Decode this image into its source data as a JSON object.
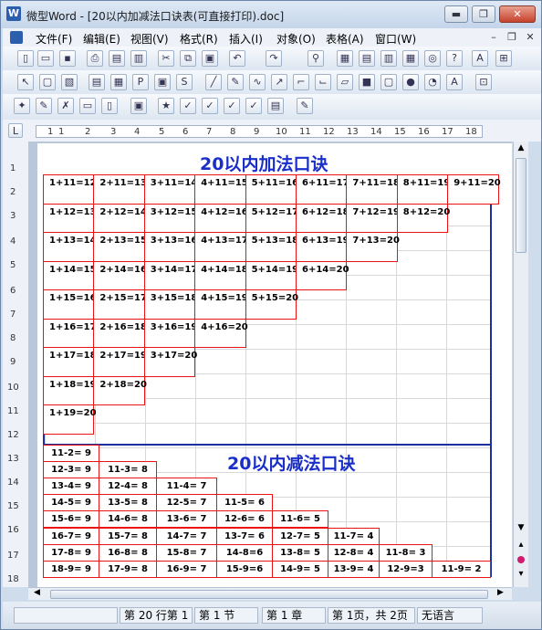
{
  "window": {
    "title": "微型Word - [20以内加减法口诀表(可直接打印).doc]",
    "min": "▬",
    "restore": "❐",
    "close": "✕"
  },
  "menu": [
    "文件(F)",
    "编辑(E)",
    "视图(V)",
    "格式(R)",
    "插入(I)",
    "对象(O)",
    "表格(A)",
    "窗口(W)"
  ],
  "ruler": [
    "1",
    "1",
    "2",
    "3",
    "4",
    "5",
    "6",
    "7",
    "8",
    "9",
    "10",
    "11",
    "12",
    "13",
    "14",
    "15",
    "16",
    "17",
    "18"
  ],
  "vruler": [
    "1",
    "2",
    "3",
    "4",
    "5",
    "6",
    "7",
    "8",
    "9",
    "10",
    "11",
    "12",
    "13",
    "14",
    "15",
    "16",
    "17",
    "18"
  ],
  "doc": {
    "add_title": "20以内加法口诀",
    "sub_title": "20以内减法口诀",
    "add_rows": [
      [
        "1+11=12",
        "2+11=13",
        "3+11=14",
        "4+11=15",
        "5+11=16",
        "6+11=17",
        "7+11=18",
        "8+11=19",
        "9+11=20"
      ],
      [
        "1+12=13",
        "2+12=14",
        "3+12=15",
        "4+12=16",
        "5+12=17",
        "6+12=18",
        "7+12=19",
        "8+12=20"
      ],
      [
        "1+13=14",
        "2+13=15",
        "3+13=16",
        "4+13=17",
        "5+13=18",
        "6+13=19",
        "7+13=20"
      ],
      [
        "1+14=15",
        "2+14=16",
        "3+14=17",
        "4+14=18",
        "5+14=19",
        "6+14=20"
      ],
      [
        "1+15=16",
        "2+15=17",
        "3+15=18",
        "4+15=19",
        "5+15=20"
      ],
      [
        "1+16=17",
        "2+16=18",
        "3+16=19",
        "4+16=20"
      ],
      [
        "1+17=18",
        "2+17=19",
        "3+17=20"
      ],
      [
        "1+18=19",
        "2+18=20"
      ],
      [
        "1+19=20"
      ]
    ],
    "sub_rows": [
      [
        "11-2= 9"
      ],
      [
        "12-3= 9",
        "11-3= 8"
      ],
      [
        "13-4= 9",
        "12-4= 8",
        "11-4= 7"
      ],
      [
        "14-5= 9",
        "13-5= 8",
        "12-5= 7",
        "11-5= 6"
      ],
      [
        "15-6= 9",
        "14-6= 8",
        "13-6= 7",
        "12-6= 6",
        "11-6= 5"
      ],
      [
        "16-7= 9",
        "15-7= 8",
        "14-7= 7",
        "13-7= 6",
        "12-7= 5",
        "11-7= 4"
      ],
      [
        "17-8= 9",
        "16-8= 8",
        "15-8= 7",
        "14-8=6",
        "13-8= 5",
        "12-8= 4",
        "11-8= 3"
      ],
      [
        "18-9= 9",
        "17-9= 8",
        "16-9= 7",
        "15-9=6",
        "14-9= 5",
        "13-9= 4",
        "12-9=3",
        "11-9= 2"
      ]
    ]
  },
  "status": [
    "第 20 行第 1",
    "第 1 节",
    "第 1 章",
    "第 1页，共 2页",
    "无语言"
  ]
}
